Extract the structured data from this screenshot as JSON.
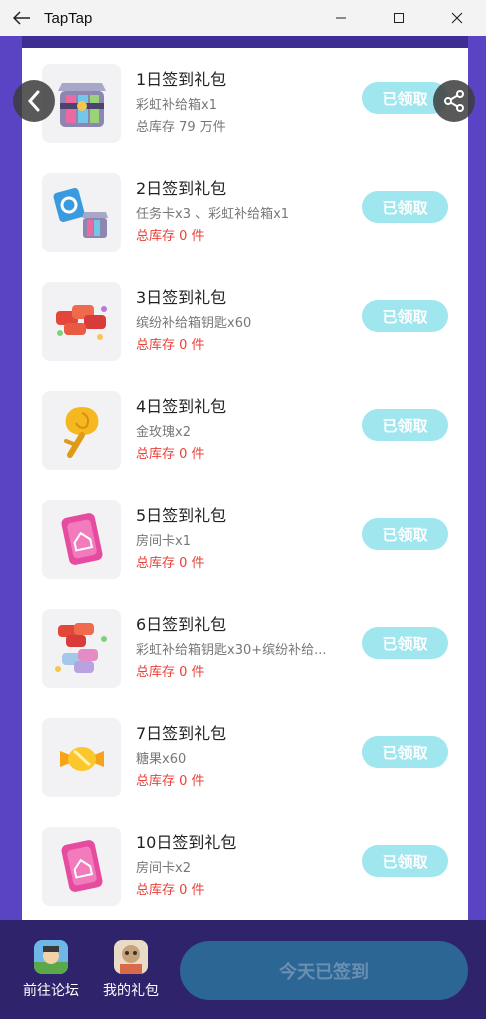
{
  "window": {
    "title": "TapTap",
    "back_icon": "arrow-left-icon",
    "minimize_icon": "minimize-icon",
    "maximize_icon": "maximize-icon",
    "close_icon": "close-icon"
  },
  "colors": {
    "background": "#5b44c4",
    "claim_button": "#9fe6ee",
    "stock_empty": "#e8423b",
    "bottom_bar": "#2f236b",
    "signin_button": "#2c6695"
  },
  "gifts": [
    {
      "title": "1日签到礼包",
      "desc": "彩虹补给箱x1",
      "stock": "总库存 79 万件",
      "stock_empty": false,
      "button": "已领取",
      "icon": "rainbow-crate-icon"
    },
    {
      "title": "2日签到礼包",
      "desc": "任务卡x3 、彩虹补给箱x1",
      "stock": "总库存 0 件",
      "stock_empty": true,
      "button": "已领取",
      "icon": "task-card-crate-icon"
    },
    {
      "title": "3日签到礼包",
      "desc": "缤纷补给箱钥匙x60",
      "stock": "总库存 0 件",
      "stock_empty": true,
      "button": "已领取",
      "icon": "colorful-keys-icon"
    },
    {
      "title": "4日签到礼包",
      "desc": "金玫瑰x2",
      "stock": "总库存 0 件",
      "stock_empty": true,
      "button": "已领取",
      "icon": "golden-rose-icon"
    },
    {
      "title": "5日签到礼包",
      "desc": "房间卡x1",
      "stock": "总库存 0 件",
      "stock_empty": true,
      "button": "已领取",
      "icon": "room-card-icon"
    },
    {
      "title": "6日签到礼包",
      "desc": "彩虹补给箱钥匙x30+缤纷补给...",
      "stock": "总库存 0 件",
      "stock_empty": true,
      "button": "已领取",
      "icon": "mixed-keys-icon"
    },
    {
      "title": "7日签到礼包",
      "desc": "糖果x60",
      "stock": "总库存 0 件",
      "stock_empty": true,
      "button": "已领取",
      "icon": "candy-icon"
    },
    {
      "title": "10日签到礼包",
      "desc": "房间卡x2",
      "stock": "总库存 0 件",
      "stock_empty": true,
      "button": "已领取",
      "icon": "room-card-icon"
    }
  ],
  "floating": {
    "back_icon": "chevron-left-icon",
    "share_icon": "share-icon"
  },
  "bottom": {
    "forum_label": "前往论坛",
    "gifts_label": "我的礼包",
    "signin_label": "今天已签到"
  }
}
